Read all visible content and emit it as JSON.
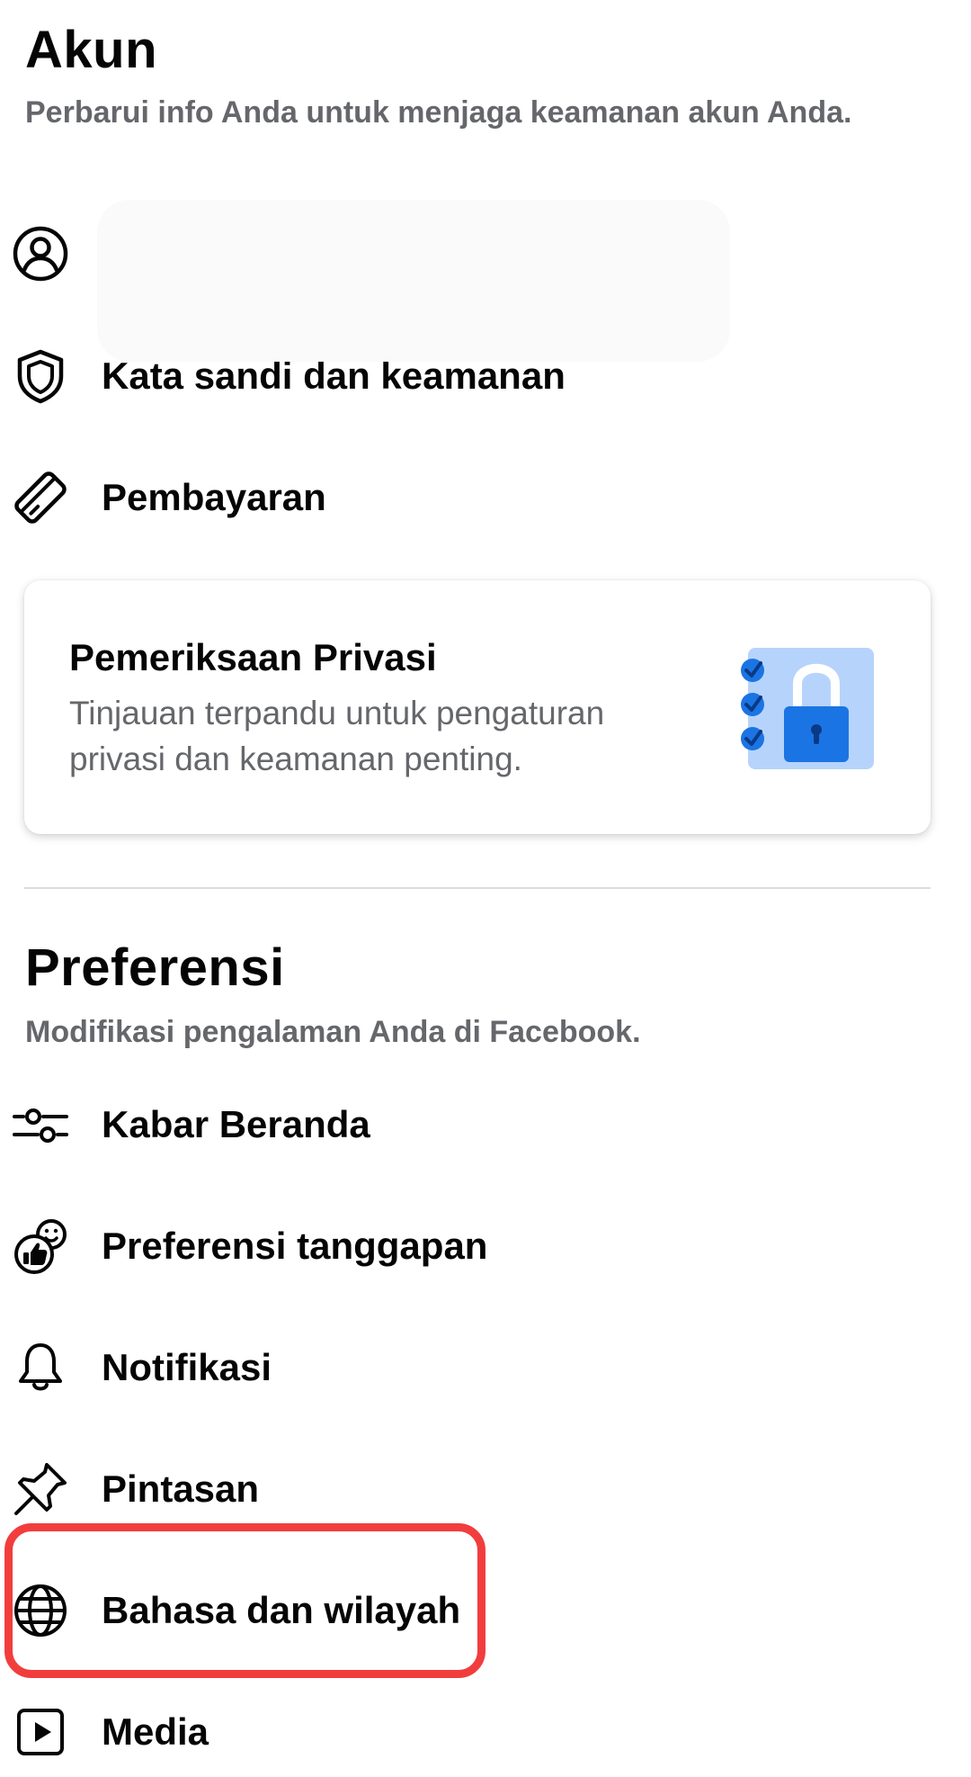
{
  "account": {
    "title": "Akun",
    "subtitle": "Perbarui info Anda untuk menjaga keamanan akun Anda.",
    "items": [
      {
        "label": "",
        "icon": "profile-circle-icon"
      },
      {
        "label": "Kata sandi dan keamanan",
        "icon": "shield-icon"
      },
      {
        "label": "Pembayaran",
        "icon": "card-icon"
      }
    ]
  },
  "privacy_check": {
    "title": "Pemeriksaan Privasi",
    "description": "Tinjauan terpandu untuk pengaturan privasi dan keamanan penting.",
    "illustration": "padlock-checklist-icon",
    "accent_color": "#1877f2"
  },
  "preferences": {
    "title": "Preferensi",
    "subtitle": "Modifikasi pengalaman Anda di Facebook.",
    "items": [
      {
        "label": "Kabar Beranda",
        "icon": "sliders-icon"
      },
      {
        "label": "Preferensi tanggapan",
        "icon": "reactions-icon"
      },
      {
        "label": "Notifikasi",
        "icon": "bell-icon"
      },
      {
        "label": "Pintasan",
        "icon": "pin-icon"
      },
      {
        "label": "Bahasa dan wilayah",
        "icon": "globe-icon"
      },
      {
        "label": "Media",
        "icon": "media-icon"
      }
    ]
  },
  "highlight_color": "#f23d3d"
}
